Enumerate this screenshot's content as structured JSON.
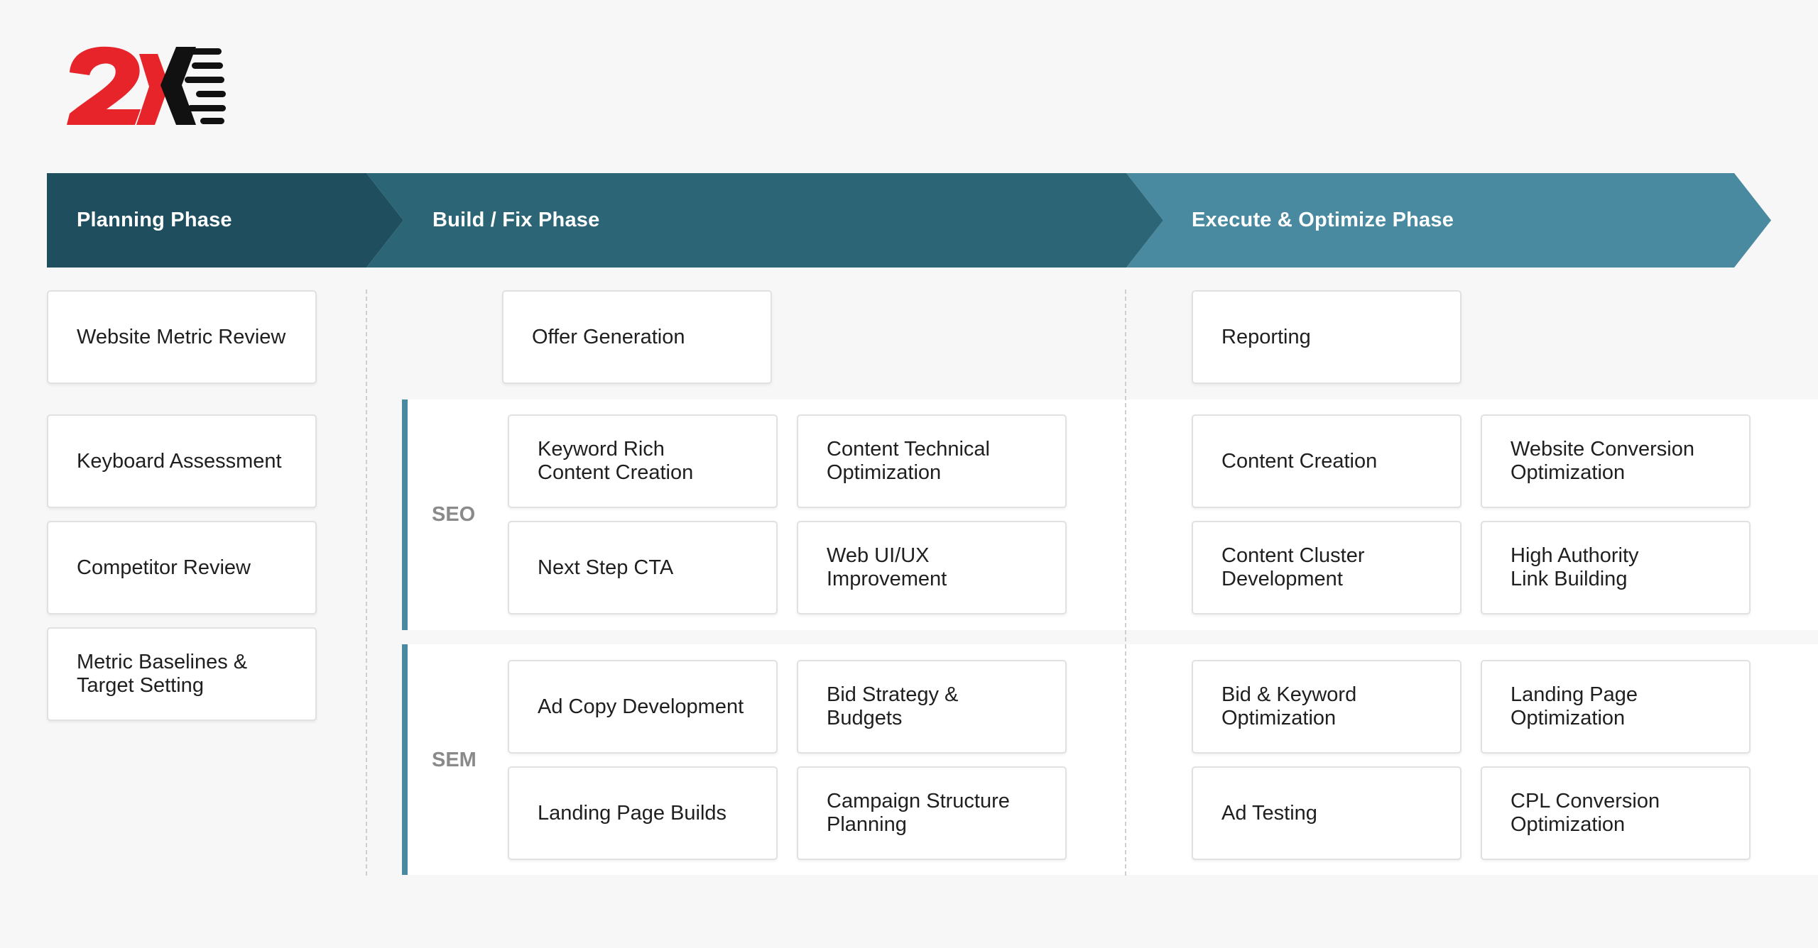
{
  "logo": {
    "text": "2X"
  },
  "colors": {
    "planning": "#1f4f5e",
    "build": "#2c6676",
    "execute": "#4a8aa0",
    "logo_red": "#e8242b",
    "logo_black": "#111111"
  },
  "phases": [
    {
      "label": "Planning Phase"
    },
    {
      "label": "Build / Fix Phase"
    },
    {
      "label": "Execute & Optimize Phase"
    }
  ],
  "sections": {
    "seo": "SEO",
    "sem": "SEM"
  },
  "planning_cards": [
    "Website Metric Review",
    "Keyboard Assessment",
    "Competitor Review",
    "Metric Baselines &\nTarget Setting"
  ],
  "build": {
    "top": "Offer Generation",
    "seo": [
      "Keyword Rich\nContent Creation",
      "Content Technical\nOptimization",
      "Next Step CTA",
      "Web UI/UX\nImprovement"
    ],
    "sem": [
      "Ad Copy Development",
      "Bid Strategy &\nBudgets",
      "Landing Page Builds",
      "Campaign Structure\nPlanning"
    ]
  },
  "execute": {
    "top": "Reporting",
    "seo": [
      "Content Creation",
      "Website Conversion\nOptimization",
      "Content Cluster\nDevelopment",
      "High Authority\nLink Building"
    ],
    "sem": [
      "Bid & Keyword\nOptimization",
      "Landing Page\nOptimization",
      "Ad Testing",
      "CPL Conversion\nOptimization"
    ]
  }
}
